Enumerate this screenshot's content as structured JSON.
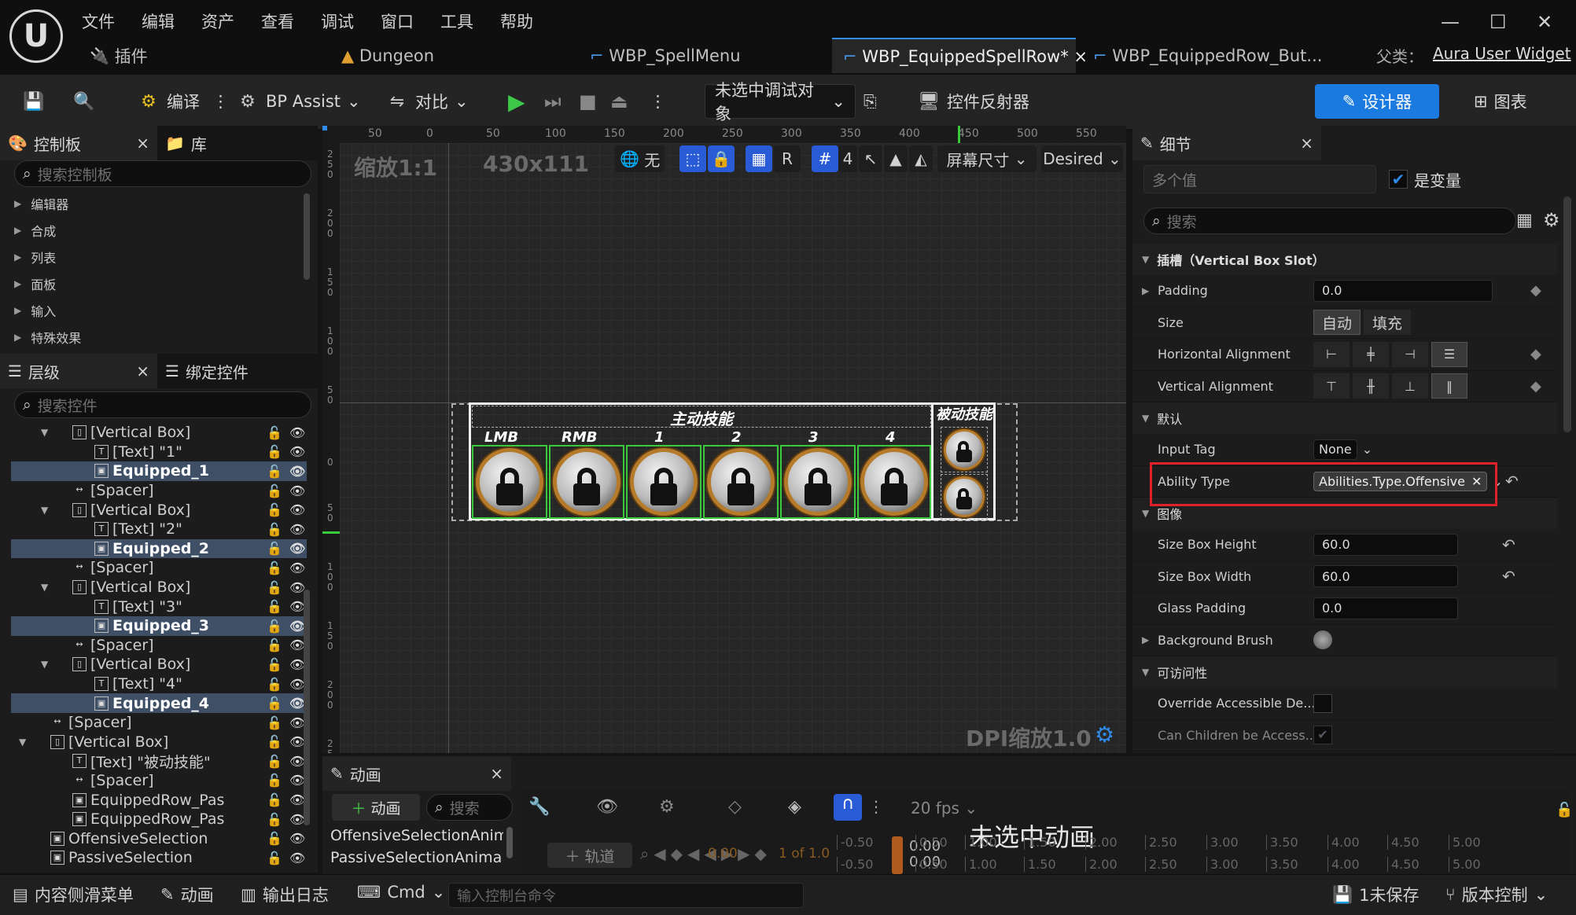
{
  "menu": [
    "文件",
    "编辑",
    "资产",
    "查看",
    "调试",
    "窗口",
    "工具",
    "帮助"
  ],
  "tabs": {
    "plugin": "插件",
    "dungeon": "Dungeon",
    "spellmenu": "WBP_SpellMenu",
    "equippedspellrow": "WBP_EquippedSpellRow*",
    "equippedrowbut": "WBP_EquippedRow_But...",
    "parent_label": "父类：",
    "parent_value": "Aura User Widget"
  },
  "toolbar": {
    "compile": "编译",
    "bp_assist": "BP Assist",
    "diff": "对比",
    "debug_target": "未选中调试对象",
    "widget_reflector": "控件反射器",
    "designer": "设计器",
    "graph": "图表"
  },
  "palette": {
    "tab_palette": "控制板",
    "tab_library": "库",
    "search_placeholder": "搜索控制板",
    "categories": [
      "编辑器",
      "合成",
      "列表",
      "面板",
      "输入",
      "特殊效果"
    ]
  },
  "hierarchy": {
    "tab_hierarchy": "层级",
    "tab_bind": "绑定控件",
    "search_placeholder": "搜索控件",
    "rows": [
      {
        "label": "[Vertical Box]",
        "indent": 1,
        "kind": "vbox",
        "sel": false
      },
      {
        "label": "[Text] \"1\"",
        "indent": 2,
        "kind": "text",
        "sel": false
      },
      {
        "label": "Equipped_1",
        "indent": 2,
        "kind": "widget",
        "sel": true
      },
      {
        "label": "[Spacer]",
        "indent": 1,
        "kind": "spacer",
        "sel": false
      },
      {
        "label": "[Vertical Box]",
        "indent": 1,
        "kind": "vbox",
        "sel": false
      },
      {
        "label": "[Text] \"2\"",
        "indent": 2,
        "kind": "text",
        "sel": false
      },
      {
        "label": "Equipped_2",
        "indent": 2,
        "kind": "widget",
        "sel": true
      },
      {
        "label": "[Spacer]",
        "indent": 1,
        "kind": "spacer",
        "sel": false
      },
      {
        "label": "[Vertical Box]",
        "indent": 1,
        "kind": "vbox",
        "sel": false
      },
      {
        "label": "[Text] \"3\"",
        "indent": 2,
        "kind": "text",
        "sel": false
      },
      {
        "label": "Equipped_3",
        "indent": 2,
        "kind": "widget",
        "sel": true
      },
      {
        "label": "[Spacer]",
        "indent": 1,
        "kind": "spacer",
        "sel": false
      },
      {
        "label": "[Vertical Box]",
        "indent": 1,
        "kind": "vbox",
        "sel": false
      },
      {
        "label": "[Text] \"4\"",
        "indent": 2,
        "kind": "text",
        "sel": false
      },
      {
        "label": "Equipped_4",
        "indent": 2,
        "kind": "widget",
        "sel": true
      },
      {
        "label": "[Spacer]",
        "indent": 0,
        "kind": "spacer",
        "sel": false
      },
      {
        "label": "[Vertical Box]",
        "indent": 0,
        "kind": "vbox",
        "sel": false
      },
      {
        "label": "[Text] \"被动技能\"",
        "indent": 1,
        "kind": "text",
        "sel": false
      },
      {
        "label": "[Spacer]",
        "indent": 1,
        "kind": "spacer",
        "sel": false
      },
      {
        "label": "EquippedRow_Pas",
        "indent": 1,
        "kind": "widget",
        "sel": false
      },
      {
        "label": "EquippedRow_Pas",
        "indent": 1,
        "kind": "widget",
        "sel": false
      },
      {
        "label": "OffensiveSelection",
        "indent": 0,
        "kind": "widget",
        "sel": false
      },
      {
        "label": "PassiveSelection",
        "indent": 0,
        "kind": "widget",
        "sel": false
      }
    ]
  },
  "viewport": {
    "zoom": "缩放1:1",
    "size": "430x111",
    "none_label": "无",
    "r_label": "R",
    "grid_num": "4",
    "screen_size": "屏幕尺寸",
    "desired": "Desired",
    "dpi": "DPI缩放1.0",
    "ruler_top": [
      "50",
      "0",
      "50",
      "100",
      "150",
      "200",
      "250",
      "300",
      "350",
      "400",
      "450",
      "500",
      "550"
    ],
    "ruler_left": [
      "2\n5\n0",
      "2\n0\n0",
      "1\n5\n0",
      "1\n0\n0",
      "5\n0",
      "0",
      "5\n0",
      "1\n0\n0",
      "1\n5\n0",
      "2\n0\n0",
      "2\n5\n0",
      "3\n0\n0"
    ],
    "active_title": "主动技能",
    "passive_title": "被动技能",
    "slot_labels": [
      "LMB",
      "RMB",
      "1",
      "2",
      "3",
      "4"
    ]
  },
  "details": {
    "tab": "细节",
    "multi_value": "多个值",
    "is_variable": "是变量",
    "search_placeholder": "搜索",
    "sec_slot": "插槽（Vertical Box Slot）",
    "padding_label": "Padding",
    "padding_value": "0.0",
    "size_label": "Size",
    "size_auto": "自动",
    "size_fill": "填充",
    "halign_label": "Horizontal Alignment",
    "valign_label": "Vertical Alignment",
    "sec_default": "默认",
    "input_tag_label": "Input Tag",
    "input_tag_value": "None",
    "ability_type_label": "Ability Type",
    "ability_type_value": "Abilities.Type.Offensive",
    "sec_image": "图像",
    "size_box_height_label": "Size Box Height",
    "size_box_height_value": "60.0",
    "size_box_width_label": "Size Box Width",
    "size_box_width_value": "60.0",
    "glass_padding_label": "Glass Padding",
    "glass_padding_value": "0.0",
    "background_brush_label": "Background Brush",
    "sec_access": "可访问性",
    "override_label": "Override Accessible De...",
    "children_label": "Can Children be Access..."
  },
  "animation": {
    "tab": "动画",
    "add_anim": "动画",
    "search_placeholder": "搜索",
    "items": [
      "OffensiveSelectionAnim",
      "PassiveSelectionAnima"
    ],
    "track": "轨道",
    "fps": "20 fps",
    "no_anim": "未选中动画",
    "time_a": "0.00",
    "time_b": "0.00",
    "time_c": "0.00",
    "time_d": "1 of 1.0",
    "ticks_top": [
      "-0.50",
      "0.50",
      "1.00",
      "1.50",
      "2.00",
      "2.50",
      "3.00",
      "3.50",
      "4.00",
      "4.50",
      "5.00"
    ],
    "ticks_bottom": [
      "-0.50",
      "0.50",
      "1.00",
      "1.50",
      "2.00",
      "2.50",
      "3.00",
      "3.50",
      "4.00",
      "4.50",
      "5.00"
    ]
  },
  "bottom": {
    "content_drawer": "内容侧滑菜单",
    "anim": "动画",
    "output_log": "输出日志",
    "cmd": "Cmd",
    "console_placeholder": "输入控制台命令",
    "unsaved": "1未保存",
    "source_control": "版本控制"
  },
  "colors": {
    "accent": "#2f8ae8",
    "designer_btn": "#1a7ae0",
    "highlight_red": "#e0202a",
    "slot_green": "#3ac93a",
    "selected_row": "#3e4f66"
  }
}
